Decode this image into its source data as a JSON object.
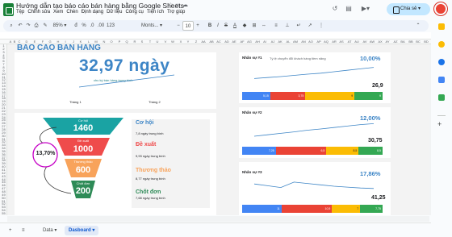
{
  "app": {
    "title": "Hướng dẫn tạo báo cáo bán hàng bằng Google Sheets",
    "menu": [
      "Tệp",
      "Chỉnh sửa",
      "Xem",
      "Chèn",
      "Định dạng",
      "Dữ liệu",
      "Công cụ",
      "Tiện ích",
      "Trợ giúp"
    ],
    "share_label": "Chia sẻ"
  },
  "toolbar": {
    "zoom": "85%",
    "currency": "đ",
    "percent": "%",
    "dec_less": ".0",
    "dec_more": ".00",
    "num_format": "123",
    "font": "Monts...",
    "font_size": "10"
  },
  "columns": [
    "A",
    "B",
    "C",
    "D",
    "E",
    "F",
    "G",
    "H",
    "I",
    "J",
    "K",
    "L",
    "M",
    "N",
    "O",
    "P",
    "Q",
    "R",
    "S",
    "T",
    "U",
    "V",
    "W",
    "X",
    "Y",
    "Z",
    "AA",
    "AB",
    "AC",
    "AD",
    "AE",
    "AF",
    "AG",
    "AH",
    "AI",
    "AJ",
    "AK",
    "AL",
    "AM",
    "AN",
    "AO",
    "AP",
    "AQ",
    "AR",
    "AS",
    "AT",
    "AU",
    "AV",
    "AW",
    "AX",
    "AY",
    "AZ",
    "BA",
    "BB",
    "BC",
    "BD"
  ],
  "rows": [
    "1",
    "2",
    "3",
    "4",
    "5",
    "6",
    "7",
    "8",
    "9",
    "10",
    "11",
    "12",
    "13",
    "14",
    "15",
    "16",
    "17",
    "18",
    "19",
    "20",
    "21",
    "22",
    "23",
    "24",
    "25",
    "26",
    "27",
    "28",
    "29",
    "30",
    "31",
    "32",
    "33",
    "34",
    "35",
    "36",
    "37",
    "38",
    "39",
    "40",
    "41",
    "42",
    "43",
    "44",
    "45",
    "46",
    "47",
    "48",
    "49",
    "50",
    "51",
    "52",
    "53",
    "54",
    "55"
  ],
  "dashboard": {
    "heading": "BÁO CÁO BÁN HÀNG",
    "avg_days": "32,97 ngày",
    "avg_sub": "chu kỳ bán hàng trung bình",
    "trend": {
      "months": [
        "Tháng 1",
        "Tháng 2"
      ]
    },
    "funnel": {
      "conversion": "13,70%",
      "stages": [
        {
          "label": "Cơ hội",
          "value": "1460",
          "color": "#1aa3a3"
        },
        {
          "label": "Đề xuất",
          "value": "1000",
          "color": "#ef4b4b"
        },
        {
          "label": "Thương thảo",
          "value": "600",
          "color": "#f8a35b"
        },
        {
          "label": "Chốt đơn",
          "value": "200",
          "color": "#2e8b57"
        }
      ]
    },
    "stage_details": [
      {
        "title": "Cơ hội",
        "desc": "7,8 ngày trung bình",
        "color": "#3d85c6"
      },
      {
        "title": "Đề xuất",
        "desc": "9,93 ngày trung bình",
        "color": "#ef4b4b"
      },
      {
        "title": "Thương thảo",
        "desc": "8,77 ngày trung bình",
        "color": "#f8a35b"
      },
      {
        "title": "Chốt đơn",
        "desc": "7,68 ngày trung bình",
        "color": "#2e8b57"
      }
    ],
    "agents": [
      {
        "name": "Nhân sự #1",
        "caption": "Tỷ lệ chuyển đổi khách hàng tiềm năng",
        "pct": "10,00%",
        "days": "26,9",
        "trend": [
          0.42,
          0.46,
          0.5,
          0.55,
          0.6,
          0.64,
          0.7,
          0.76,
          0.82,
          0.88
        ],
        "bar": [
          {
            "label": "5,15",
            "w": 0.2,
            "color": "#4285f4"
          },
          {
            "label": "3,75",
            "w": 0.25,
            "color": "#ea4335"
          },
          {
            "label": "9",
            "w": 0.35,
            "color": "#fbbc04"
          },
          {
            "label": "9",
            "w": 0.2,
            "color": "#34a853"
          }
        ]
      },
      {
        "name": "Nhân sự #2",
        "caption": "",
        "pct": "12,00%",
        "days": "30,75",
        "trend": [
          0.3,
          0.36,
          0.42,
          0.48,
          0.55,
          0.6,
          0.66,
          0.72,
          0.78,
          0.82
        ],
        "bar": [
          {
            "label": "7,25",
            "w": 0.24,
            "color": "#4285f4"
          },
          {
            "label": "6,5",
            "w": 0.36,
            "color": "#ea4335"
          },
          {
            "label": "8,5",
            "w": 0.23,
            "color": "#fbbc04"
          },
          {
            "label": "8,5",
            "w": 0.17,
            "color": "#34a853"
          }
        ]
      },
      {
        "name": "Nhân sự #3",
        "caption": "",
        "pct": "17,86%",
        "days": "41,25",
        "trend": [
          0.78,
          0.7,
          0.62,
          0.86,
          0.8,
          0.74,
          0.68,
          0.64,
          0.6,
          0.58
        ],
        "bar": [
          {
            "label": "11",
            "w": 0.28,
            "color": "#4285f4"
          },
          {
            "label": "10,5",
            "w": 0.36,
            "color": "#ea4335"
          },
          {
            "label": "7",
            "w": 0.2,
            "color": "#fbbc04"
          },
          {
            "label": "7,75",
            "w": 0.16,
            "color": "#34a853"
          }
        ]
      }
    ]
  },
  "sheet_tabs": [
    {
      "label": "Data",
      "active": false
    },
    {
      "label": "Dasboard",
      "active": true
    }
  ],
  "colors": {
    "accent": "#3d85c6",
    "brand": "#188038",
    "share": "#c2e7ff"
  }
}
